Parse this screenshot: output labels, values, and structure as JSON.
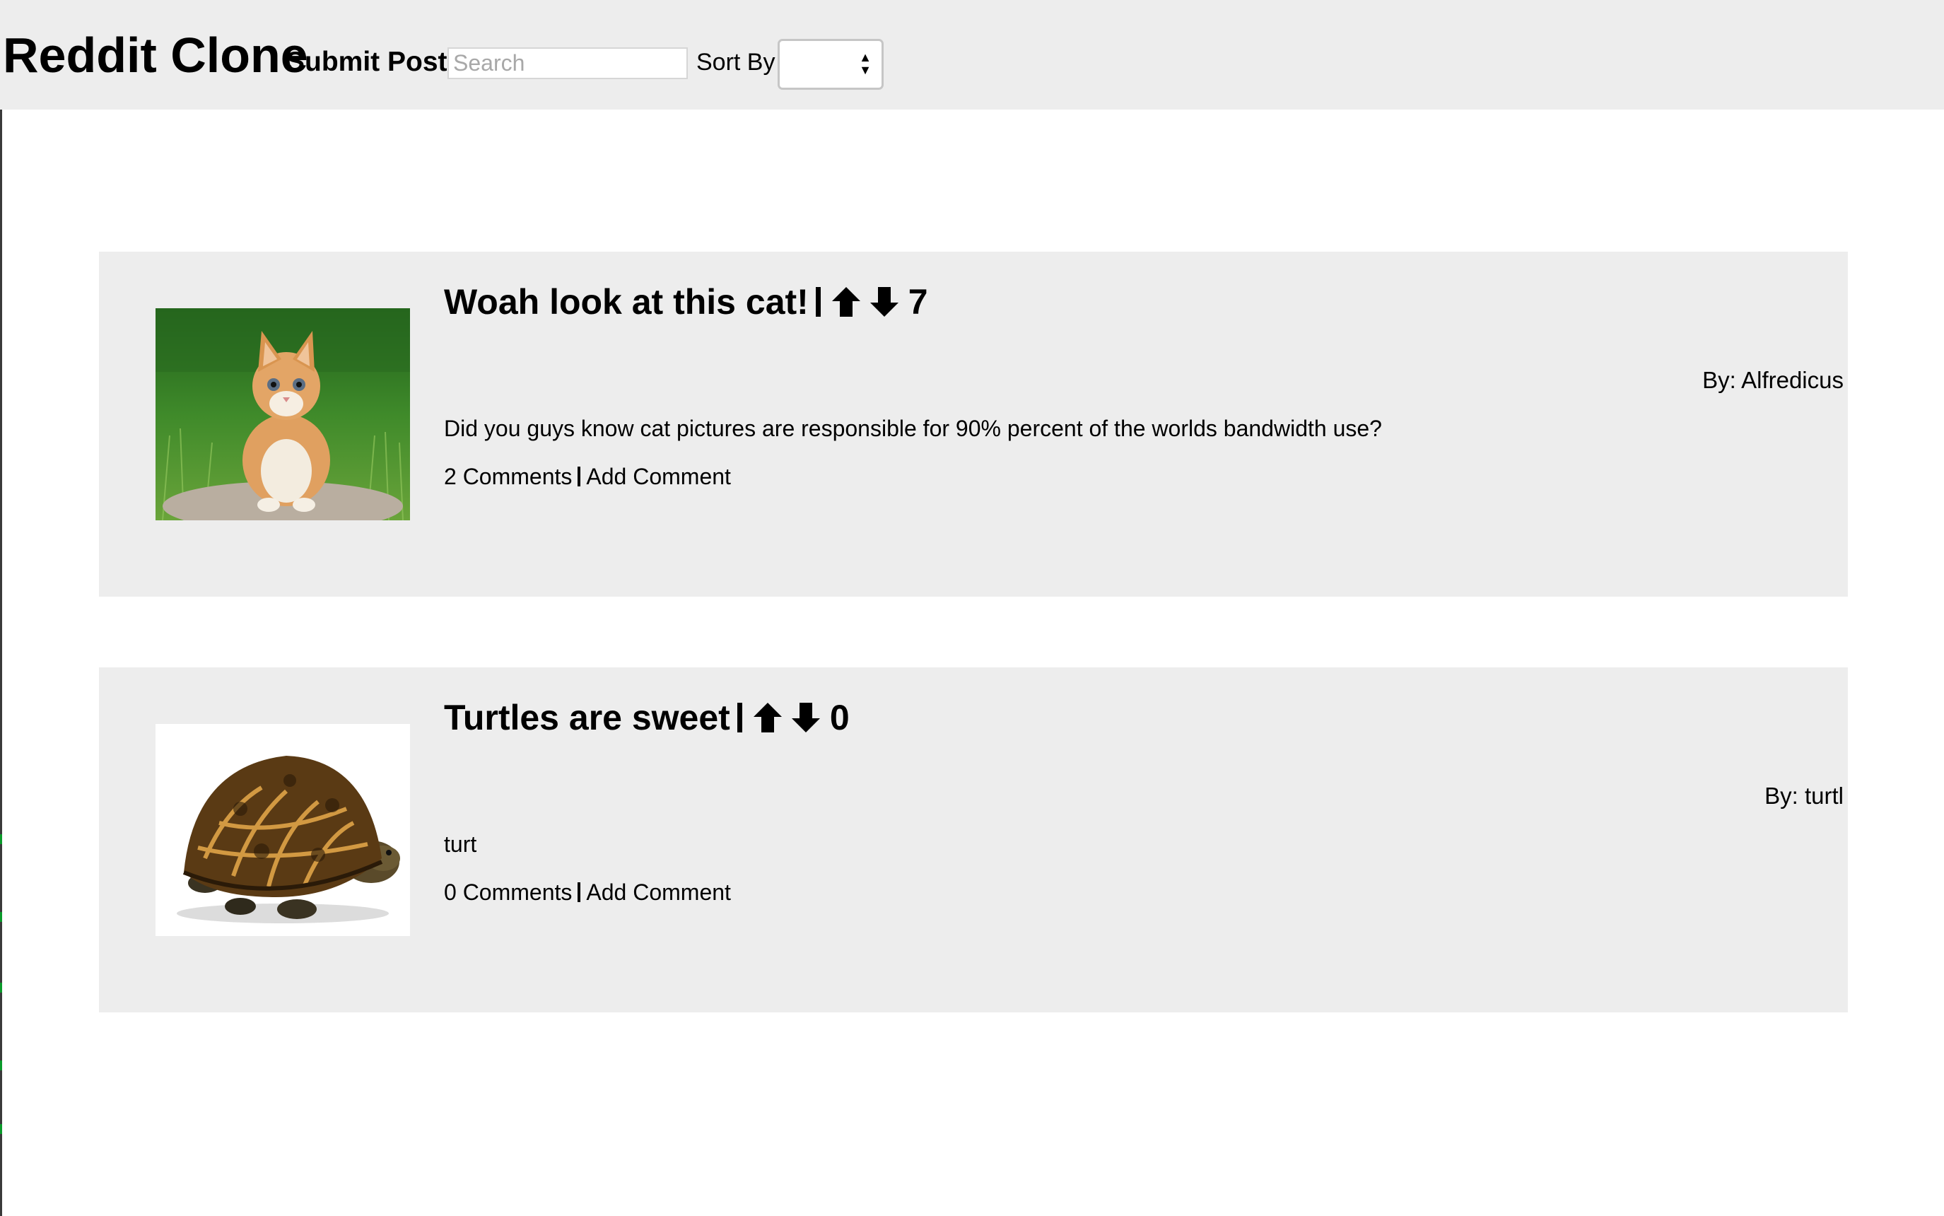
{
  "header": {
    "brand": "Reddit Clone",
    "submit_label": "Submit Post",
    "search_placeholder": "Search",
    "sort_label": "Sort By",
    "sort_value": ""
  },
  "posts": [
    {
      "title": "Woah look at this cat!",
      "score": "7",
      "author": "By: Alfredicus",
      "body": "Did you guys know cat pictures are responsible for 90% percent of the worlds bandwidth use?",
      "comments": "2 Comments",
      "add_comment": "Add Comment",
      "image": "kitten-photo"
    },
    {
      "title": "Turtles are sweet",
      "score": "0",
      "author": "By: turtl",
      "body": "turt",
      "comments": "0 Comments",
      "add_comment": "Add Comment",
      "image": "turtle-photo"
    }
  ]
}
